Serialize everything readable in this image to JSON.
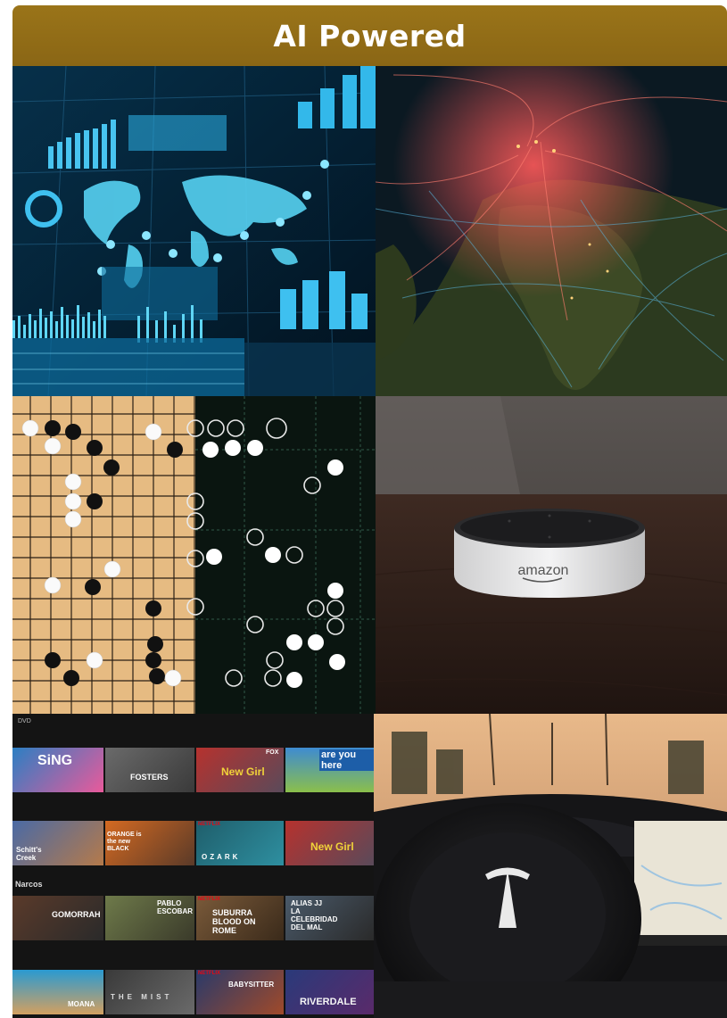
{
  "banner": {
    "title": "AI Powered",
    "color": "#8f6b17"
  },
  "tiles": [
    {
      "name": "analytics-dashboard-photo",
      "subject": "data dashboard with world map"
    },
    {
      "name": "global-network-map-photo",
      "subject": "glowing network connections over world map"
    },
    {
      "name": "go-board-photo",
      "subject": "go game board with stones"
    },
    {
      "name": "smart-speaker-photo",
      "subject": "smart speaker on wooden table",
      "brand_text": "amazon"
    },
    {
      "name": "streaming-catalog-screenshot",
      "subject": "video streaming catalog",
      "section_labels": {
        "top": "DVD",
        "middle": "Narcos"
      },
      "rows": [
        [
          "SiNG",
          "FOSTERS",
          "New Girl",
          "are you here"
        ],
        [
          "Schitt's Creek",
          "ORANGE is the new BLACK",
          "OZARK",
          "New Girl"
        ],
        [
          "GOMORRAH",
          "PABLO ESCOBAR",
          "SUBURRA BLOOD ON ROME",
          "ALIAS JJ LA CELEBRIDAD DEL MAL"
        ],
        [
          "MOANA",
          "THE MIST",
          "BABYSITTER",
          "RIVERDALE"
        ]
      ],
      "badges": {
        "netflix": "NETFLIX",
        "fox": "FOX"
      }
    },
    {
      "name": "self-driving-car-photo",
      "subject": "car interior with steering wheel and touchscreen"
    }
  ]
}
